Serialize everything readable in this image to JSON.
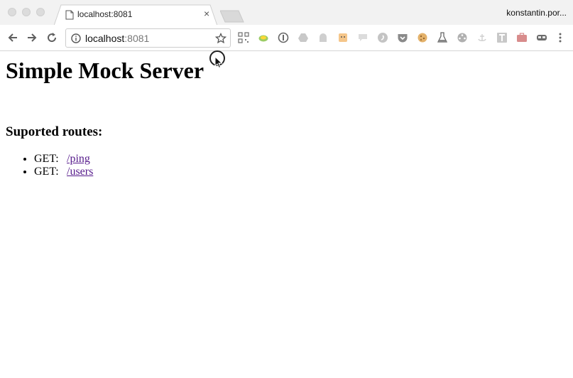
{
  "window": {
    "tab": {
      "title": "localhost:8081",
      "favicon": "document-icon",
      "close_glyph": "×"
    },
    "profile_name": "konstantin.por..."
  },
  "toolbar": {
    "url": {
      "host": "localhost",
      "port": ":8081"
    },
    "extensions": [
      "qr-code-icon",
      "turtle-icon",
      "onepassword-icon",
      "drive-icon",
      "ghost-icon",
      "face-icon",
      "speech-bubble-icon",
      "stylus-icon",
      "pocket-icon",
      "cookie-icon",
      "flask-icon",
      "film-reel-icon",
      "anchor-icon",
      "text-t-icon",
      "briefcase-icon",
      "mask-icon"
    ]
  },
  "page": {
    "title": "Simple Mock Server",
    "routes_heading": "Suported routes:",
    "routes": [
      {
        "method": "GET:",
        "path": "/ping"
      },
      {
        "method": "GET:",
        "path": "/users"
      }
    ]
  }
}
